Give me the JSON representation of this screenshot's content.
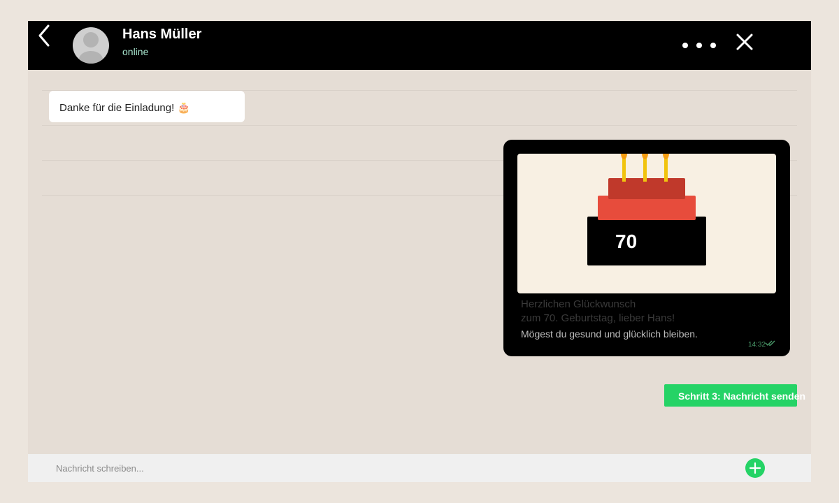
{
  "header": {
    "contact_name": "Hans Müller",
    "status": "online"
  },
  "messages": {
    "incoming": {
      "text": "Danke für die Einladung! 🎂"
    },
    "outgoing": {
      "card_number": "70",
      "line1": "Herzlichen Glückwunsch",
      "line2": "zum 70. Geburtstag, lieber Hans!",
      "line3": "Mögest du gesund und glücklich bleiben.",
      "time": "14:32"
    }
  },
  "step_button": {
    "label": "Schritt 3: Nachricht senden"
  },
  "compose": {
    "placeholder": "Nachricht schreiben..."
  },
  "colors": {
    "accent": "#25d366",
    "header_bg": "#000000",
    "chat_bg": "#e5ddd5",
    "card_bg": "#f8f0e3",
    "cake_top": "#c0392b",
    "cake_mid": "#e74c3c",
    "candle": "#f1c40f",
    "flame": "#f39c12"
  },
  "icons": {
    "back": "chevron-left-icon",
    "menu": "more-dots-icon",
    "close": "close-icon",
    "add": "plus-icon",
    "avatar": "user-silhouette-icon",
    "read": "double-check-icon"
  }
}
